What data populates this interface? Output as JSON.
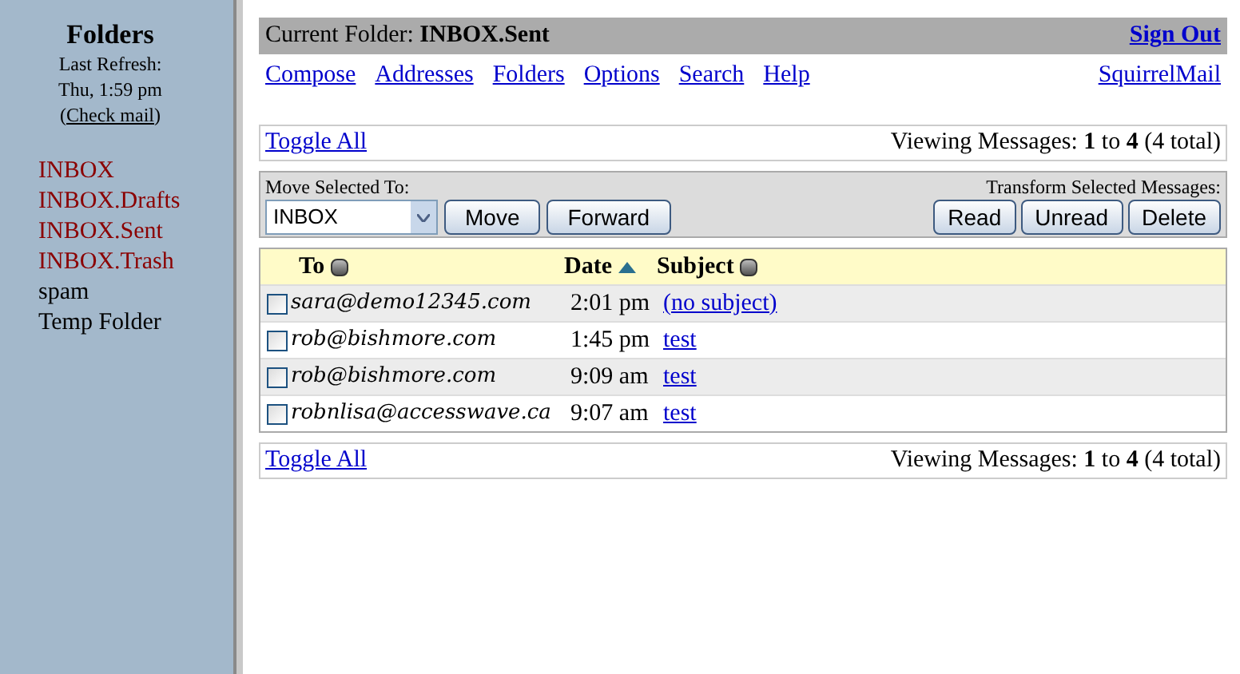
{
  "sidebar": {
    "title": "Folders",
    "refresh_label": "Last Refresh:",
    "refresh_time": "Thu, 1:59 pm",
    "check_mail_open": "(",
    "check_mail": "Check mail",
    "check_mail_close": ")",
    "folders": [
      {
        "name": "INBOX",
        "color": "#8b0000"
      },
      {
        "name": "INBOX.Drafts",
        "color": "#8b0000"
      },
      {
        "name": "INBOX.Sent",
        "color": "#8b0000"
      },
      {
        "name": "INBOX.Trash",
        "color": "#8b0000"
      },
      {
        "name": "spam",
        "color": "#000000"
      },
      {
        "name": "Temp Folder",
        "color": "#000000"
      }
    ]
  },
  "header": {
    "label": "Current Folder:",
    "folder": "INBOX.Sent",
    "sign_out": "Sign Out"
  },
  "nav": [
    "Compose",
    "Addresses",
    "Folders",
    "Options",
    "Search",
    "Help"
  ],
  "brand_link": "SquirrelMail",
  "toggle_all": "Toggle All",
  "viewing": "Viewing Messages: **1** to **4** (4 total)",
  "move": {
    "label": "Move Selected To:",
    "folder": "INBOX",
    "buttons": [
      "Move",
      "Forward"
    ]
  },
  "transform": {
    "label": "Transform Selected Messages:",
    "buttons": [
      "Read",
      "Unread",
      "Delete"
    ]
  },
  "columns": [
    {
      "label": "To",
      "sorted": false
    },
    {
      "label": "Date",
      "sorted": true
    },
    {
      "label": "Subject",
      "sorted": false
    }
  ],
  "messages": [
    {
      "to": "sara@demo12345.com",
      "date": "2:01 pm",
      "subject": "(no subject)",
      "checked": false
    },
    {
      "to": "rob@bishmore.com",
      "date": "1:45 pm",
      "subject": "test",
      "checked": false
    },
    {
      "to": "rob@bishmore.com",
      "date": "9:09 am",
      "subject": "test",
      "checked": false
    },
    {
      "to": "robnlisa@accesswave.ca",
      "date": "9:07 am",
      "subject": "test",
      "checked": false
    }
  ],
  "footer": {
    "toggle_all": "Toggle All",
    "viewing": "Viewing Messages: **1** to **4** (4 total)"
  }
}
